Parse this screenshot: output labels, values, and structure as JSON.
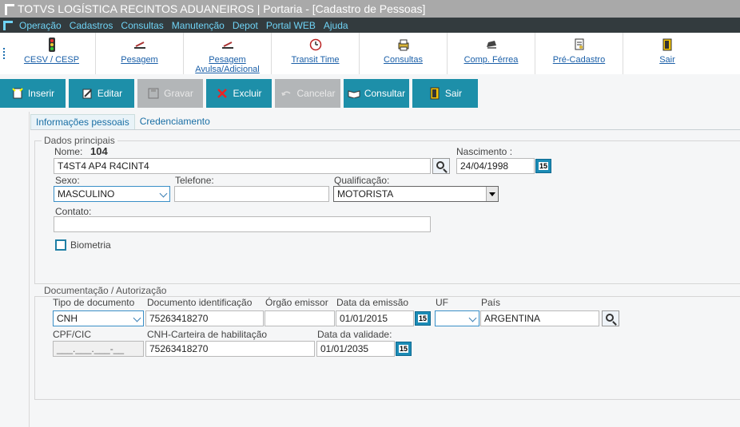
{
  "window": {
    "title": "TOTVS LOGÍSTICA RECINTOS ADUANEIROS | Portaria - [Cadastro de Pessoas]"
  },
  "menu": [
    "Operação",
    "Cadastros",
    "Consultas",
    "Manutenção",
    "Depot",
    "Portal WEB",
    "Ajuda"
  ],
  "toolbar": {
    "items": [
      {
        "label": "CESV / CESP",
        "icon": "traffic-light-icon"
      },
      {
        "label": "Pesagem",
        "icon": "scale-icon"
      },
      {
        "label": "Pesagem Avulsa/Adicional",
        "icon": "scale-icon"
      },
      {
        "label": "Transit Time",
        "icon": "clock-icon"
      },
      {
        "label": "Consultas",
        "icon": "printer-icon"
      },
      {
        "label": "Comp. Férrea",
        "icon": "train-icon"
      },
      {
        "label": "Pré-Cadastro",
        "icon": "document-icon"
      },
      {
        "label": "Sair",
        "icon": "exit-door-icon"
      }
    ]
  },
  "actions": {
    "insert": "Inserir",
    "edit": "Editar",
    "save": "Gravar",
    "delete": "Excluir",
    "cancel": "Cancelar",
    "consult": "Consultar",
    "exit": "Sair"
  },
  "tabs": {
    "personal": "Informações pessoais",
    "accreditation": "Credenciamento"
  },
  "main_data": {
    "group_title": "Dados principais",
    "name_label": "Nome:",
    "name_code": "104",
    "name_value": "T4ST4 AP4 R4CINT4",
    "birth_label": "Nascimento :",
    "birth_value": "24/04/1998",
    "sex_label": "Sexo:",
    "sex_value": "MASCULINO",
    "phone_label": "Telefone:",
    "phone_value": "",
    "qualification_label": "Qualificação:",
    "qualification_value": "MOTORISTA",
    "contact_label": "Contato:",
    "contact_value": "",
    "biometrics_label": "Biometria"
  },
  "documents": {
    "group_title": "Documentação / Autorização",
    "doc_type_label": "Tipo de documento",
    "doc_type_value": "CNH",
    "doc_id_label": "Documento identificação",
    "doc_id_value": "75263418270",
    "issuer_label": "Órgão emissor",
    "issuer_value": "",
    "issue_date_label": "Data da emissão",
    "issue_date_value": "01/01/2015",
    "uf_label": "UF",
    "uf_value": "",
    "country_label": "País",
    "country_value": "ARGENTINA",
    "cpf_label": "CPF/CIC",
    "cpf_value": "___.___.___-__",
    "cnh_label": "CNH-Carteira de habilitação",
    "cnh_value": "75263418270",
    "validity_label": "Data da validade:",
    "validity_value": "01/01/2035"
  },
  "calendar_badge": "15",
  "colors": {
    "accent": "#1d8fa9",
    "menubar": "#333b3e",
    "menu_text": "#6fd3f5",
    "titlebar": "#a9a9a9",
    "link": "#1a5fa8"
  }
}
